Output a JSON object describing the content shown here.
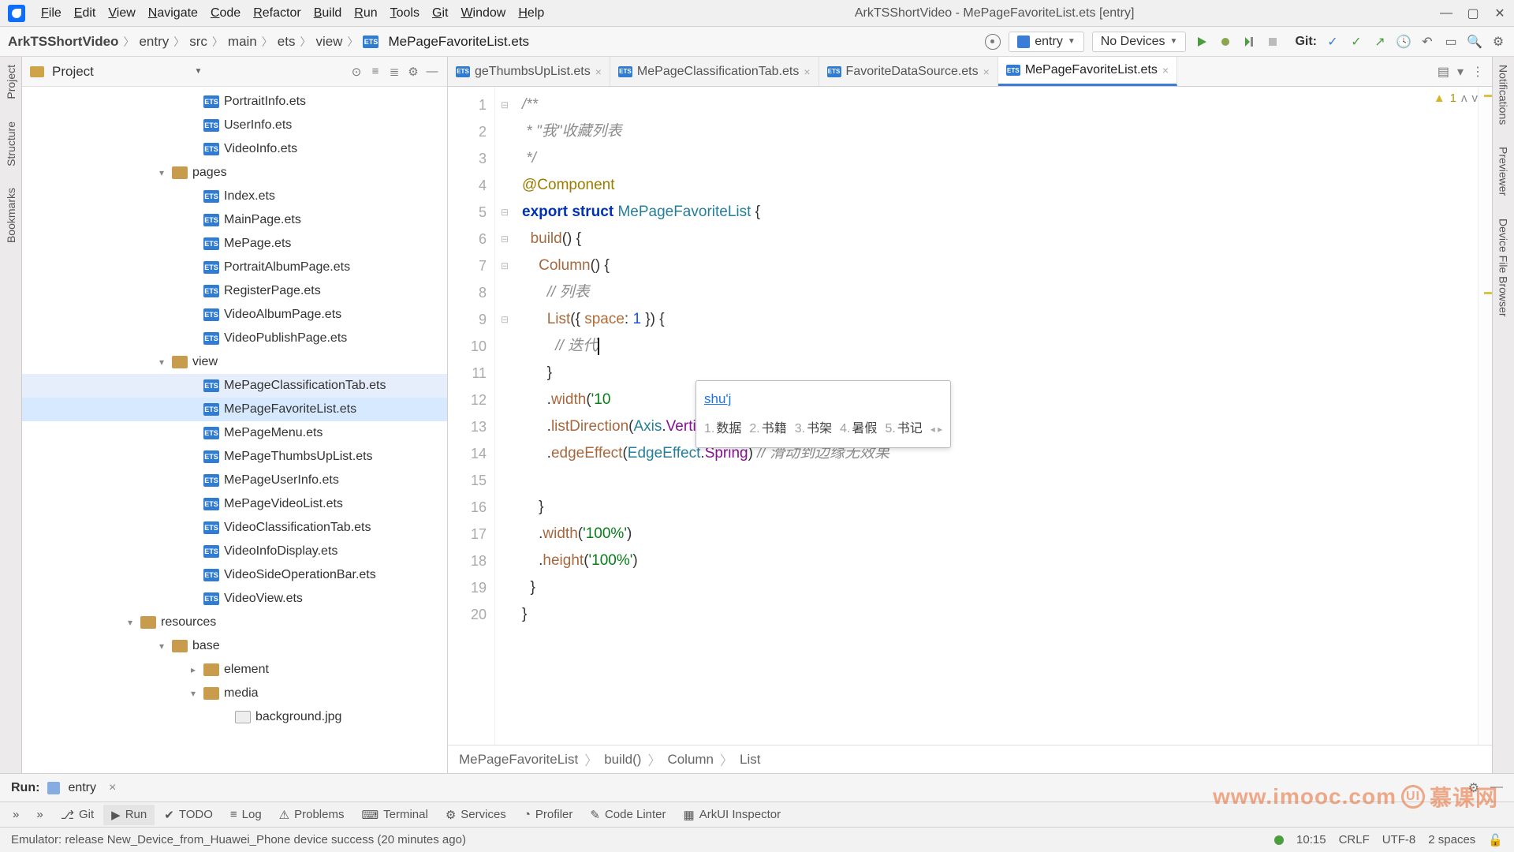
{
  "window": {
    "title": "ArkTSShortVideo - MePageFavoriteList.ets [entry]"
  },
  "menu": [
    "File",
    "Edit",
    "View",
    "Navigate",
    "Code",
    "Refactor",
    "Build",
    "Run",
    "Tools",
    "Git",
    "Window",
    "Help"
  ],
  "breadcrumb": [
    "ArkTSShortVideo",
    "entry",
    "src",
    "main",
    "ets",
    "view",
    "MePageFavoriteList.ets"
  ],
  "run_config": "entry",
  "device_select": "No Devices",
  "git_label": "Git:",
  "project": {
    "label": "Project"
  },
  "tree": [
    {
      "indent": 210,
      "icon": "ets",
      "label": "PortraitInfo.ets"
    },
    {
      "indent": 210,
      "icon": "ets",
      "label": "UserInfo.ets"
    },
    {
      "indent": 210,
      "icon": "ets",
      "label": "VideoInfo.ets"
    },
    {
      "indent": 170,
      "icon": "folder",
      "chev": "▾",
      "label": "pages"
    },
    {
      "indent": 210,
      "icon": "ets",
      "label": "Index.ets"
    },
    {
      "indent": 210,
      "icon": "ets",
      "label": "MainPage.ets"
    },
    {
      "indent": 210,
      "icon": "ets",
      "label": "MePage.ets"
    },
    {
      "indent": 210,
      "icon": "ets",
      "label": "PortraitAlbumPage.ets"
    },
    {
      "indent": 210,
      "icon": "ets",
      "label": "RegisterPage.ets"
    },
    {
      "indent": 210,
      "icon": "ets",
      "label": "VideoAlbumPage.ets"
    },
    {
      "indent": 210,
      "icon": "ets",
      "label": "VideoPublishPage.ets"
    },
    {
      "indent": 170,
      "icon": "folder",
      "chev": "▾",
      "label": "view"
    },
    {
      "indent": 210,
      "icon": "ets",
      "label": "MePageClassificationTab.ets",
      "dim": true
    },
    {
      "indent": 210,
      "icon": "ets",
      "label": "MePageFavoriteList.ets",
      "sel": true
    },
    {
      "indent": 210,
      "icon": "ets",
      "label": "MePageMenu.ets"
    },
    {
      "indent": 210,
      "icon": "ets",
      "label": "MePageThumbsUpList.ets"
    },
    {
      "indent": 210,
      "icon": "ets",
      "label": "MePageUserInfo.ets"
    },
    {
      "indent": 210,
      "icon": "ets",
      "label": "MePageVideoList.ets"
    },
    {
      "indent": 210,
      "icon": "ets",
      "label": "VideoClassificationTab.ets"
    },
    {
      "indent": 210,
      "icon": "ets",
      "label": "VideoInfoDisplay.ets"
    },
    {
      "indent": 210,
      "icon": "ets",
      "label": "VideoSideOperationBar.ets"
    },
    {
      "indent": 210,
      "icon": "ets",
      "label": "VideoView.ets"
    },
    {
      "indent": 130,
      "icon": "folder",
      "chev": "▾",
      "label": "resources"
    },
    {
      "indent": 170,
      "icon": "folder",
      "chev": "▾",
      "label": "base"
    },
    {
      "indent": 210,
      "icon": "folder",
      "chev": "▸",
      "label": "element"
    },
    {
      "indent": 210,
      "icon": "folder",
      "chev": "▾",
      "label": "media"
    },
    {
      "indent": 250,
      "icon": "img",
      "label": "background.jpg"
    }
  ],
  "tabs": [
    {
      "label": "geThumbsUpList.ets",
      "close": true
    },
    {
      "label": "MePageClassificationTab.ets",
      "close": true
    },
    {
      "label": "FavoriteDataSource.ets",
      "close": true
    },
    {
      "label": "MePageFavoriteList.ets",
      "close": true,
      "active": true
    }
  ],
  "code_lines": [
    {
      "n": 1,
      "html": "<span class='com'>/**</span>"
    },
    {
      "n": 2,
      "html": "<span class='com'> * \"我\"收藏列表</span>"
    },
    {
      "n": 3,
      "html": "<span class='com'> */</span>"
    },
    {
      "n": 4,
      "html": "<span class='anno'>@Component</span>"
    },
    {
      "n": 5,
      "html": "<span class='kw'>export</span> <span class='kw'>struct</span> <span class='type'>MePageFavoriteList</span> {"
    },
    {
      "n": 6,
      "html": "  <span class='fn'>build</span>() {"
    },
    {
      "n": 7,
      "html": "    <span class='fn'>Column</span>() {"
    },
    {
      "n": 8,
      "html": "      <span class='com'>// 列表</span>"
    },
    {
      "n": 9,
      "html": "      <span class='fn'>List</span>({ <span class='id'>space</span>: <span class='num'>1</span> }) {"
    },
    {
      "n": 10,
      "html": "        <span class='com'>// 迭代</span><span class='cursor'></span>",
      "hl": true
    },
    {
      "n": 11,
      "html": "      }"
    },
    {
      "n": 12,
      "html": "      .<span class='fn'>width</span>(<span class='str'>'10"
    },
    {
      "n": 13,
      "html": "      .<span class='fn'>listDirection</span>(<span class='type'>Axis</span>.<span class='member'>Vertical</span>) <span class='com'>// 排列方向：垂直</span>"
    },
    {
      "n": 14,
      "html": "      .<span class='fn'>edgeEffect</span>(<span class='type'>EdgeEffect</span>.<span class='member'>Spring</span>) <span class='com'>// 滑动到边缘无效果</span>"
    },
    {
      "n": 15,
      "html": ""
    },
    {
      "n": 16,
      "html": "    }"
    },
    {
      "n": 17,
      "html": "    .<span class='fn'>width</span>(<span class='str'>'100%'</span>)"
    },
    {
      "n": 18,
      "html": "    .<span class='fn'>height</span>(<span class='str'>'100%'</span>)"
    },
    {
      "n": 19,
      "html": "  }"
    },
    {
      "n": 20,
      "html": "}"
    }
  ],
  "ime": {
    "input": "shu'j",
    "candidates": [
      {
        "n": "1",
        "t": "数据"
      },
      {
        "n": "2",
        "t": "书籍"
      },
      {
        "n": "3",
        "t": "书架"
      },
      {
        "n": "4",
        "t": "暑假"
      },
      {
        "n": "5",
        "t": "书记"
      }
    ]
  },
  "inspection": {
    "count": "1"
  },
  "editor_breadcrumb": [
    "MePageFavoriteList",
    "build()",
    "Column",
    "List"
  ],
  "run_panel": {
    "label": "Run:",
    "target": "entry"
  },
  "bottom_bar": [
    {
      "icon": "»",
      "label": ""
    },
    {
      "icon": "»",
      "label": ""
    },
    {
      "icon": "git",
      "label": "Git"
    },
    {
      "icon": "run",
      "label": "Run",
      "active": true
    },
    {
      "icon": "todo",
      "label": "TODO"
    },
    {
      "icon": "log",
      "label": "Log"
    },
    {
      "icon": "problems",
      "label": "Problems"
    },
    {
      "icon": "terminal",
      "label": "Terminal"
    },
    {
      "icon": "services",
      "label": "Services"
    },
    {
      "icon": "profiler",
      "label": "Profiler"
    },
    {
      "icon": "lint",
      "label": "Code Linter"
    },
    {
      "icon": "arkui",
      "label": "ArkUI Inspector"
    }
  ],
  "status": {
    "message": "Emulator: release New_Device_from_Huawei_Phone device success (20 minutes ago)",
    "pos": "10:15",
    "eol": "CRLF",
    "enc": "UTF-8",
    "indent": "2 spaces"
  },
  "watermark": {
    "url": "www.imooc.com",
    "text": "慕课网"
  },
  "gutters": {
    "left": [
      "Project",
      "Structure",
      "Bookmarks"
    ],
    "right": [
      "Notifications",
      "Previewer",
      "Device File Browser"
    ]
  }
}
